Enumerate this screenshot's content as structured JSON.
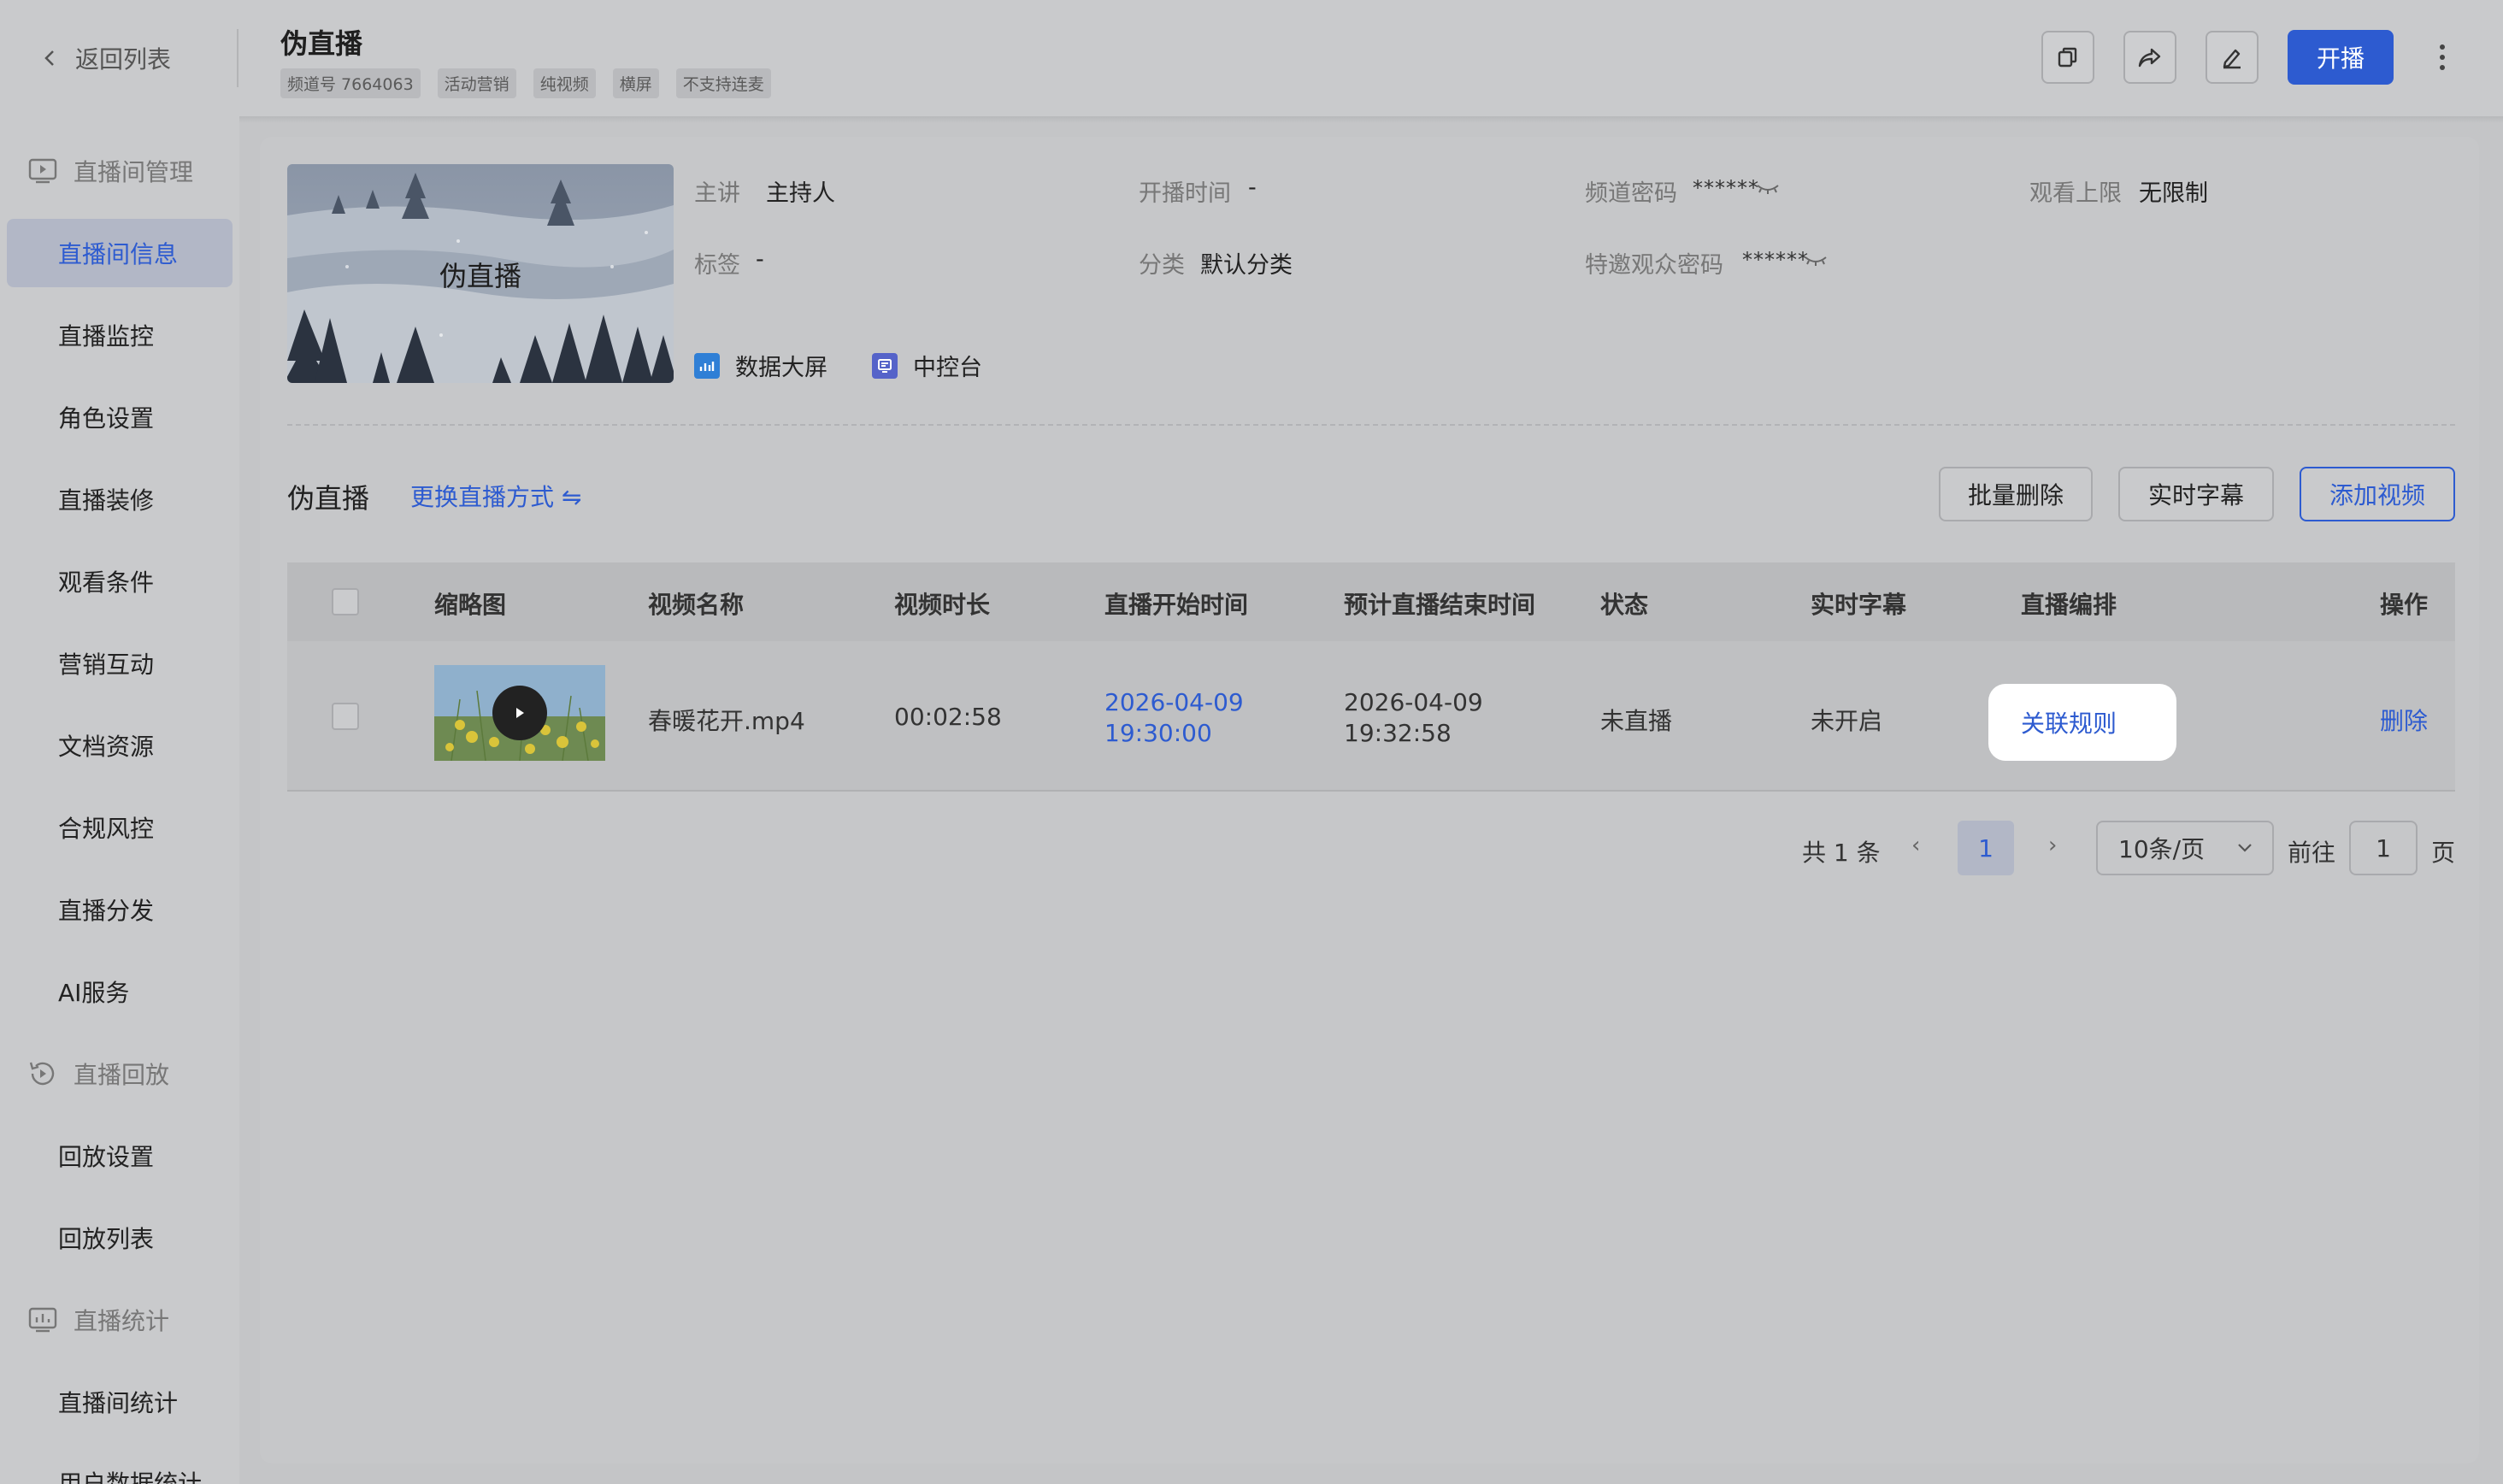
{
  "header": {
    "back_label": "返回列表",
    "title": "伪直播",
    "tags": [
      "频道号 7664063",
      "活动营销",
      "纯视频",
      "横屏",
      "不支持连麦"
    ],
    "icons": [
      "copy-icon",
      "share-icon",
      "edit-icon"
    ],
    "start_label": "开播",
    "more_icon": "more-vertical-icon"
  },
  "sidebar": {
    "groups": [
      {
        "label": "直播间管理",
        "icon": "live-room-icon"
      },
      {
        "label": "直播回放",
        "icon": "replay-icon"
      },
      {
        "label": "直播统计",
        "icon": "stats-icon"
      }
    ],
    "items": [
      {
        "label": "直播间信息",
        "active": true
      },
      {
        "label": "直播监控"
      },
      {
        "label": "角色设置"
      },
      {
        "label": "直播装修"
      },
      {
        "label": "观看条件"
      },
      {
        "label": "营销互动"
      },
      {
        "label": "文档资源"
      },
      {
        "label": "合规风控"
      },
      {
        "label": "直播分发"
      },
      {
        "label": "AI服务"
      },
      {
        "label": "回放设置"
      },
      {
        "label": "回放列表"
      },
      {
        "label": "直播间统计"
      },
      {
        "label": "用户数据统计"
      }
    ]
  },
  "info": {
    "cover_title": "伪直播",
    "speaker_label": "主讲",
    "speaker_value": "主持人",
    "start_time_label": "开播时间",
    "start_time_value": "-",
    "password_label": "频道密码",
    "password_value": "******",
    "limit_label": "观看上限",
    "limit_value": "无限制",
    "tag_label": "标签",
    "tag_value": "-",
    "category_label": "分类",
    "category_value": "默认分类",
    "guest_password_label": "特邀观众密码",
    "guest_password_value": "******",
    "dashboard_label": "数据大屏",
    "console_label": "中控台",
    "colors": {
      "accent": "#2d5bd0",
      "dashboard_icon": "#2f7fd6",
      "console_icon": "#5563c9"
    }
  },
  "section": {
    "title": "伪直播",
    "switch_label": "更换直播方式 ⇋",
    "batch_delete_label": "批量删除",
    "subtitle_label": "实时字幕",
    "add_video_label": "添加视频"
  },
  "table": {
    "columns": [
      "缩略图",
      "视频名称",
      "视频时长",
      "直播开始时间",
      "预计直播结束时间",
      "状态",
      "实时字幕",
      "直播编排",
      "操作"
    ],
    "rows": [
      {
        "name": "春暖花开.mp4",
        "duration": "00:02:58",
        "start_date": "2026-04-09",
        "start_time": "19:30:00",
        "end_date": "2026-04-09",
        "end_time": "19:32:58",
        "status": "未直播",
        "subtitle": "未开启",
        "schedule_action": "关联规则",
        "delete_action": "删除"
      }
    ]
  },
  "pagination": {
    "total": "共 1 条",
    "prev": "‹",
    "current": "1",
    "next": "›",
    "page_size": "10条/页",
    "goto_label": "前往",
    "goto_value": "1",
    "page_unit": "页"
  }
}
